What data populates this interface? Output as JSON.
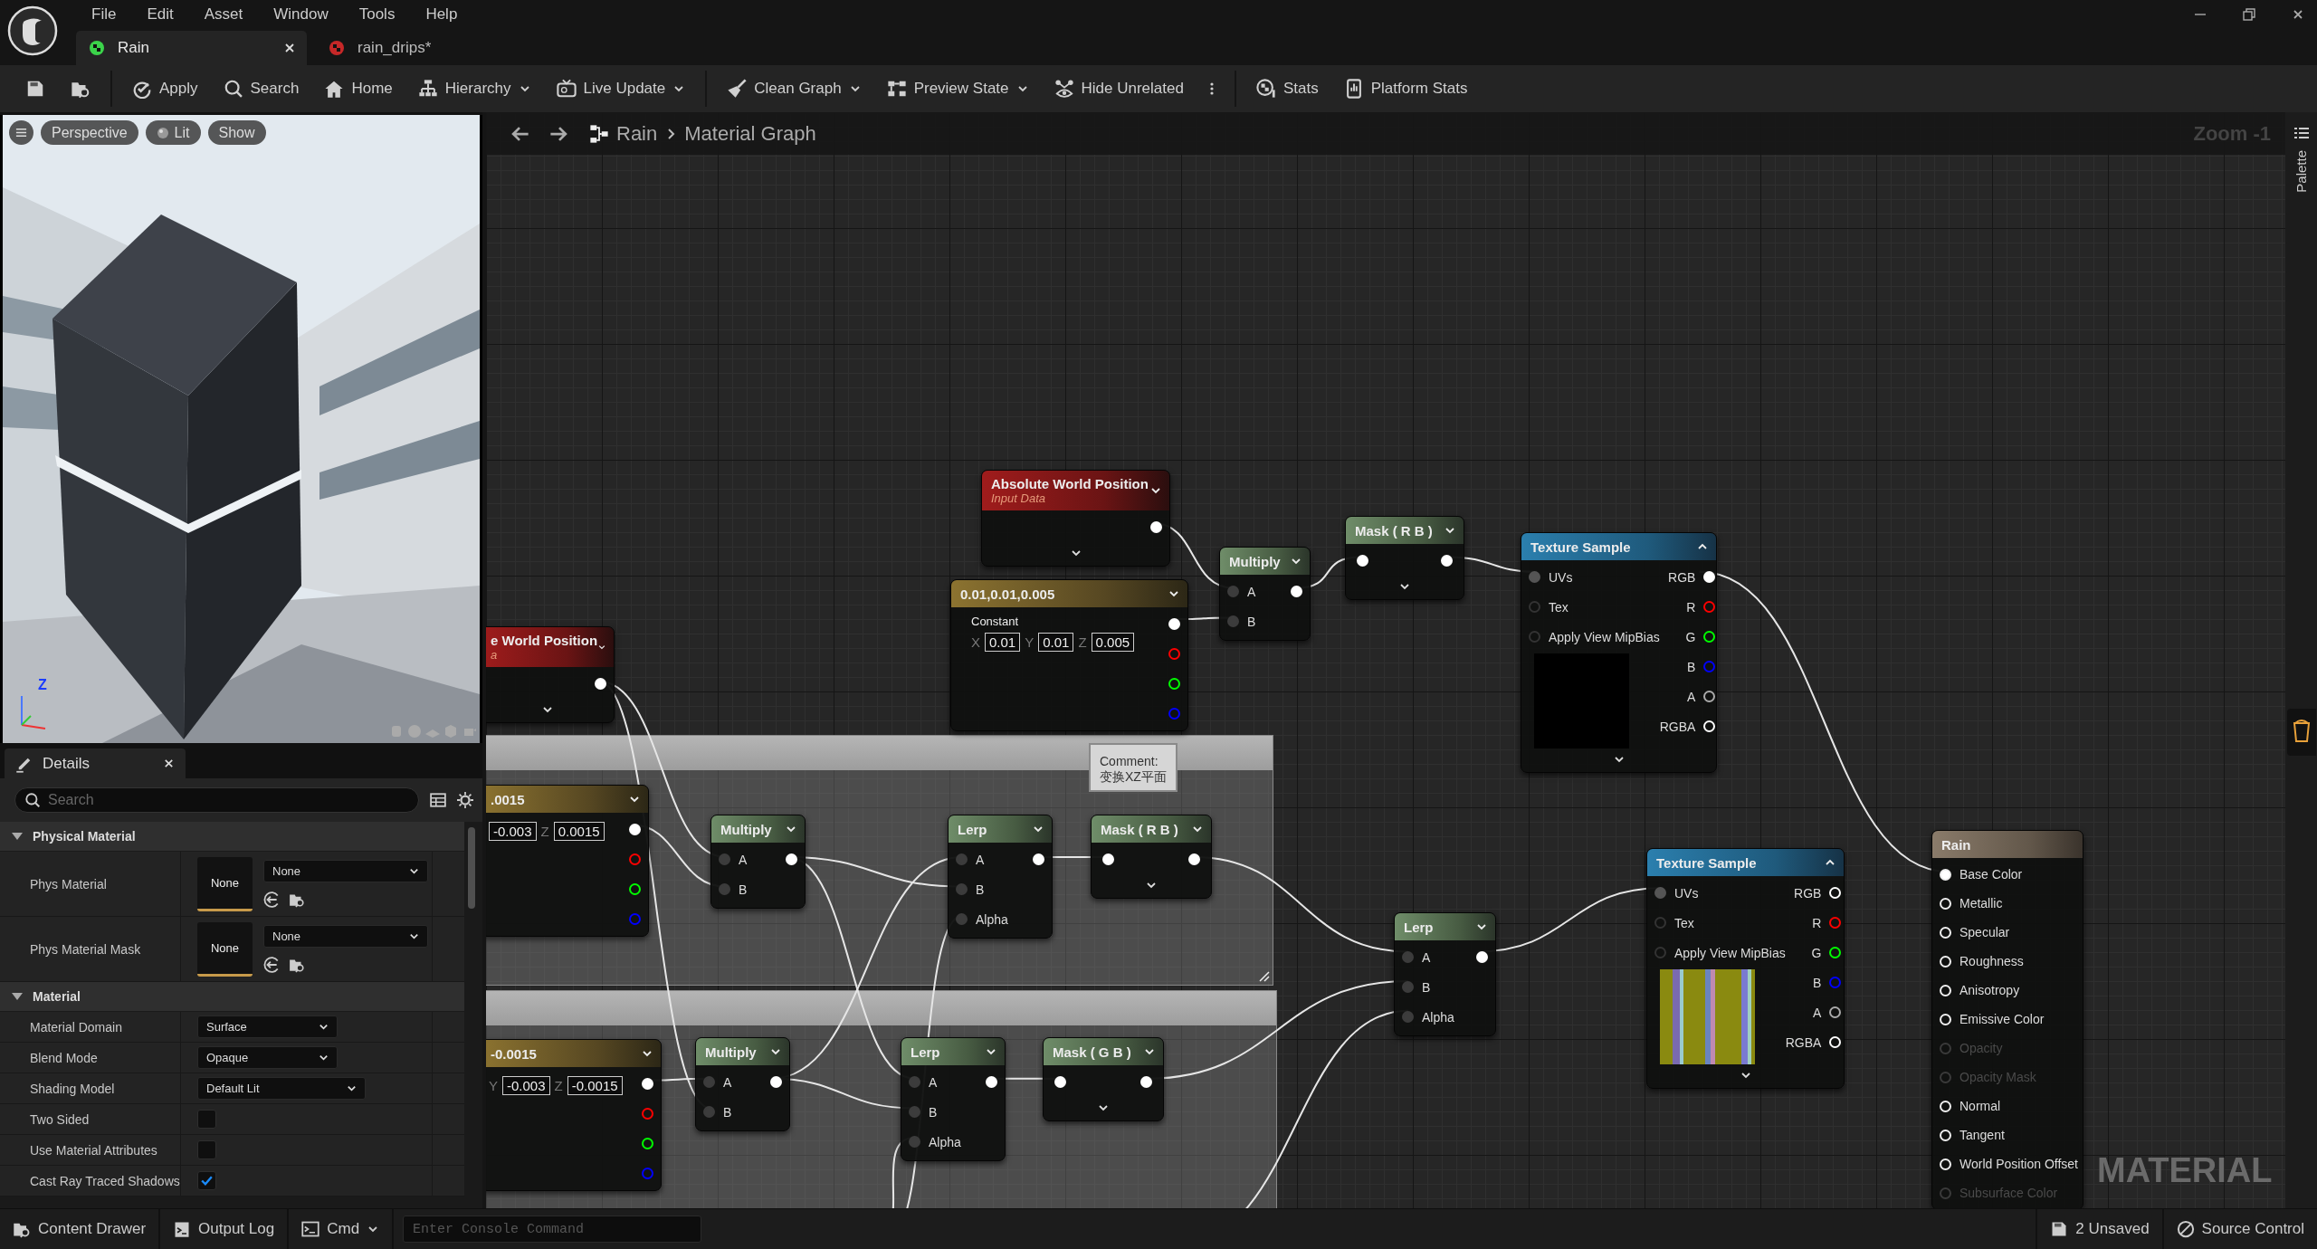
{
  "window": {
    "menu": [
      "File",
      "Edit",
      "Asset",
      "Window",
      "Tools",
      "Help"
    ]
  },
  "tabs": [
    {
      "label": "Rain",
      "selected": true
    },
    {
      "label": "rain_drips*",
      "selected": false
    }
  ],
  "toolbar": {
    "groups": [
      [
        {
          "kind": "icon"
        },
        {
          "kind": "icon"
        }
      ],
      [
        {
          "kind": "button",
          "label": "Apply",
          "dropdown": false
        },
        {
          "kind": "button",
          "label": "Search",
          "dropdown": false
        },
        {
          "kind": "button",
          "label": "Home",
          "dropdown": false
        },
        {
          "kind": "button",
          "label": "Hierarchy",
          "dropdown": true
        },
        {
          "kind": "button",
          "label": "Live Update",
          "dropdown": true
        }
      ],
      [
        {
          "kind": "button",
          "label": "Clean Graph",
          "dropdown": true
        },
        {
          "kind": "button",
          "label": "Preview State",
          "dropdown": true
        },
        {
          "kind": "button",
          "label": "Hide Unrelated",
          "dropdown": false
        },
        {
          "kind": "icon"
        }
      ],
      [
        {
          "kind": "button",
          "label": "Stats",
          "dropdown": false
        },
        {
          "kind": "button",
          "label": "Platform Stats",
          "dropdown": false
        }
      ]
    ]
  },
  "viewport": {
    "buttons": [
      "Perspective",
      "Lit",
      "Show"
    ],
    "axis_label": "Z"
  },
  "details": {
    "title": "Details",
    "search_placeholder": "Search",
    "sections": [
      {
        "title": "Physical Material",
        "expanded": true,
        "rows": [
          {
            "kind": "asset",
            "label": "Phys Material",
            "thumbnail": "None",
            "value": "None"
          },
          {
            "kind": "asset",
            "label": "Phys Material Mask",
            "thumbnail": "None",
            "value": "None"
          }
        ]
      },
      {
        "title": "Material",
        "expanded": true,
        "rows": [
          {
            "kind": "dropdown",
            "label": "Material Domain",
            "value": "Surface"
          },
          {
            "kind": "dropdown",
            "label": "Blend Mode",
            "value": "Opaque"
          },
          {
            "kind": "dropdown",
            "label": "Shading Model",
            "value": "Default Lit"
          },
          {
            "kind": "checkbox",
            "label": "Two Sided",
            "checked": false
          },
          {
            "kind": "checkbox",
            "label": "Use Material Attributes",
            "checked": false
          },
          {
            "kind": "checkbox",
            "label": "Cast Ray Traced Shadows",
            "checked": true
          }
        ]
      }
    ]
  },
  "graph": {
    "breadcrumb": [
      "Rain",
      "Material Graph"
    ],
    "zoom_label": "Zoom -1",
    "watermark": "MATERIAL",
    "comment_tooltip": "Comment:\n变换XZ平面",
    "nodes": [
      {
        "kind": "input",
        "title": "Absolute World Position",
        "subtitle": "Input Data"
      },
      {
        "kind": "constant",
        "title": "0.01,0.01,0.005",
        "label": "Constant",
        "fields": [
          {
            "axis": "X",
            "value": "0.01"
          },
          {
            "axis": "Y",
            "value": "0.01"
          },
          {
            "axis": "Z",
            "value": "0.005"
          }
        ],
        "outputs": [
          {
            "color": "#ffffff",
            "connected": true
          },
          {
            "color": "#ff0000",
            "connected": false
          },
          {
            "color": "#00ff00",
            "connected": false
          },
          {
            "color": "#0000ff",
            "connected": false
          }
        ]
      },
      {
        "kind": "math",
        "title": "Multiply",
        "inputs": [
          "A",
          "B"
        ]
      },
      {
        "kind": "mask",
        "title": "Mask ( R B )"
      },
      {
        "kind": "texture",
        "title": "Texture Sample",
        "inputs": [
          {
            "label": "UVs",
            "connected": true
          },
          {
            "label": "Tex",
            "connected": false
          },
          {
            "label": "Apply View MipBias",
            "connected": false
          }
        ],
        "preview": {
          "kind": "empty"
        },
        "outputs": [
          {
            "label": "RGB",
            "color": "#ffffff",
            "connected": true
          },
          {
            "label": "R",
            "color": "#ff0000",
            "connected": false
          },
          {
            "label": "G",
            "color": "#00ff00",
            "connected": false
          },
          {
            "label": "B",
            "color": "#0000ff",
            "connected": false
          },
          {
            "label": "A",
            "color": "#aaaaaa",
            "connected": false
          },
          {
            "label": "RGBA",
            "color": "#ffffff",
            "connected": false
          }
        ]
      },
      {
        "kind": "input",
        "title": "e World Position",
        "subtitle": "a"
      },
      {
        "kind": "constant",
        "title": ".0015",
        "fields": [
          {
            "value": "-0.003"
          },
          {
            "axis": "Z",
            "value": "0.0015"
          }
        ],
        "outputs": [
          {
            "color": "#ffffff",
            "connected": true
          },
          {
            "color": "#ff0000",
            "connected": false
          },
          {
            "color": "#00ff00",
            "connected": false
          },
          {
            "color": "#0000ff",
            "connected": false
          }
        ]
      },
      {
        "kind": "math",
        "title": "Multiply",
        "inputs": [
          "A",
          "B"
        ]
      },
      {
        "kind": "math",
        "title": "Lerp",
        "inputs": [
          "A",
          "B",
          "Alpha"
        ]
      },
      {
        "kind": "mask",
        "title": "Mask ( R B )"
      },
      {
        "kind": "constant",
        "title": "-0.0015",
        "fields": [
          {
            "axis": "Y",
            "value": "-0.003"
          },
          {
            "axis": "Z",
            "value": "-0.0015"
          }
        ],
        "outputs": [
          {
            "color": "#ffffff",
            "connected": true
          },
          {
            "color": "#ff0000",
            "connected": false
          },
          {
            "color": "#00ff00",
            "connected": false
          },
          {
            "color": "#0000ff",
            "connected": false
          }
        ]
      },
      {
        "kind": "math",
        "title": "Multiply",
        "inputs": [
          "A",
          "B"
        ]
      },
      {
        "kind": "math",
        "title": "Lerp",
        "inputs": [
          "A",
          "B",
          "Alpha"
        ]
      },
      {
        "kind": "mask",
        "title": "Mask ( G B )"
      },
      {
        "kind": "math",
        "title": "Lerp",
        "inputs": [
          "A",
          "B",
          "Alpha"
        ]
      },
      {
        "kind": "texture",
        "title": "Texture Sample",
        "inputs": [
          {
            "label": "UVs",
            "connected": true
          },
          {
            "label": "Tex",
            "connected": false
          },
          {
            "label": "Apply View MipBias",
            "connected": false
          }
        ],
        "preview": {
          "kind": "picture"
        },
        "outputs": [
          {
            "label": "RGB",
            "color": "#ffffff",
            "connected": false
          },
          {
            "label": "R",
            "color": "#ff0000",
            "connected": false
          },
          {
            "label": "G",
            "color": "#00ff00",
            "connected": false
          },
          {
            "label": "B",
            "color": "#0000ff",
            "connected": false
          },
          {
            "label": "A",
            "color": "#aaaaaa",
            "connected": false
          },
          {
            "label": "RGBA",
            "color": "#ffffff",
            "connected": false
          }
        ]
      },
      {
        "kind": "result",
        "title": "Rain",
        "inputs": [
          {
            "label": "Base Color",
            "connected": true,
            "disabled": false
          },
          {
            "label": "Metallic",
            "connected": false,
            "disabled": false
          },
          {
            "label": "Specular",
            "connected": false,
            "disabled": false
          },
          {
            "label": "Roughness",
            "connected": false,
            "disabled": false
          },
          {
            "label": "Anisotropy",
            "connected": false,
            "disabled": false
          },
          {
            "label": "Emissive Color",
            "connected": false,
            "disabled": false
          },
          {
            "label": "Opacity",
            "connected": false,
            "disabled": true
          },
          {
            "label": "Opacity Mask",
            "connected": false,
            "disabled": true
          },
          {
            "label": "Normal",
            "connected": false,
            "disabled": false
          },
          {
            "label": "Tangent",
            "connected": false,
            "disabled": false
          },
          {
            "label": "World Position Offset",
            "connected": false,
            "disabled": false
          },
          {
            "label": "Subsurface Color",
            "connected": false,
            "disabled": true
          }
        ]
      }
    ]
  },
  "palette": {
    "label": "Palette"
  },
  "status_bar": {
    "buttons": [
      {
        "label": "Content Drawer",
        "dropdown": false
      },
      {
        "label": "Output Log",
        "dropdown": false
      },
      {
        "label": "Cmd",
        "dropdown": true
      }
    ],
    "console_placeholder": "Enter Console Command",
    "unsaved": "2 Unsaved",
    "source_control": "Source Control"
  }
}
